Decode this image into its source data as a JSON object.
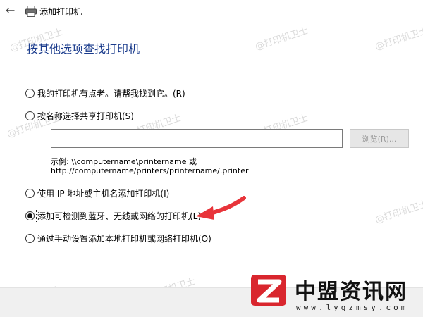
{
  "window": {
    "title": "添加打印机"
  },
  "heading": "按其他选项查找打印机",
  "options": [
    {
      "label": "我的打印机有点老。请帮我找到它。(R)",
      "checked": false
    },
    {
      "label": "按名称选择共享打印机(S)",
      "checked": false
    },
    {
      "label": "使用 IP 地址或主机名添加打印机(I)",
      "checked": false
    },
    {
      "label": "添加可检测到蓝牙、无线或网络的打印机(L)",
      "checked": true
    },
    {
      "label": "通过手动设置添加本地打印机或网络打印机(O)",
      "checked": false
    }
  ],
  "share_input": {
    "value": ""
  },
  "browse_label": "浏览(R)...",
  "example": {
    "line1": "示例: \\\\computername\\printername 或",
    "line2": "http://computername/printers/printername/.printer"
  },
  "watermark": "@打印机卫士",
  "brand": {
    "name": "中盟资讯网",
    "url": "www.lygzmsy.com"
  },
  "colors": {
    "heading": "#1a3b8c",
    "arrow": "#e8343a",
    "logo": "#d9262e"
  }
}
